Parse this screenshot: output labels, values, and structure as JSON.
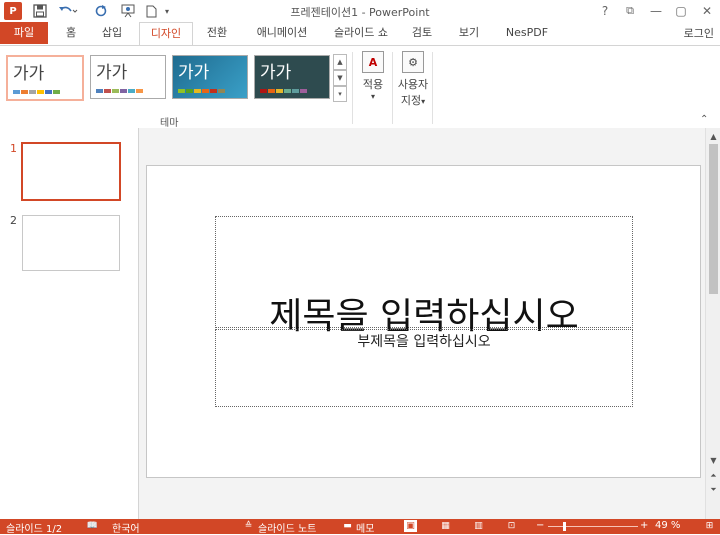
{
  "window": {
    "title": "프레젠테이션1 - PowerPoint",
    "app_icon_label": "P",
    "help": "?",
    "min": "—",
    "restore": "▢",
    "close": "✕",
    "ribbon_display": "⧉"
  },
  "tabs": [
    {
      "label": "파일"
    },
    {
      "label": "홈"
    },
    {
      "label": "삽입"
    },
    {
      "label": "디자인"
    },
    {
      "label": "전환"
    },
    {
      "label": "애니메이션"
    },
    {
      "label": "슬라이드 쇼"
    },
    {
      "label": "검토"
    },
    {
      "label": "보기"
    },
    {
      "label": "NesPDF"
    }
  ],
  "active_tab": "디자인",
  "login": "로그인",
  "ribbon": {
    "themes": [
      {
        "label": "가가",
        "bg": "#ffffff",
        "fg": "#222222"
      },
      {
        "label": "가가",
        "bg": "#ffffff",
        "fg": "#222222"
      },
      {
        "label": "가가",
        "bg": "#2d7fa6",
        "fg": "#ffffff"
      },
      {
        "label": "가가",
        "bg": "#2e4b4f",
        "fg": "#ffffff"
      }
    ],
    "group_label": "테마",
    "apply_label": "적용",
    "apply_icon_glyph": "A",
    "custom_label_1": "사용자",
    "custom_label_2": "지정",
    "custom_icon_glyph": "⚙",
    "dropdown_arrow": "▾"
  },
  "slides": [
    {
      "number": "1",
      "selected": true
    },
    {
      "number": "2",
      "selected": false
    }
  ],
  "slide": {
    "title_placeholder": "제목을 입력하십시오",
    "subtitle_placeholder": "부제목을 입력하십시오"
  },
  "status": {
    "slide_info": "슬라이드 1/2",
    "language": "한국어",
    "notes": "슬라이드 노트",
    "comments": "메모",
    "zoom_percent": "49 %",
    "zoom_minus": "−",
    "zoom_plus": "+"
  },
  "colors": {
    "accent": "#d24726"
  }
}
